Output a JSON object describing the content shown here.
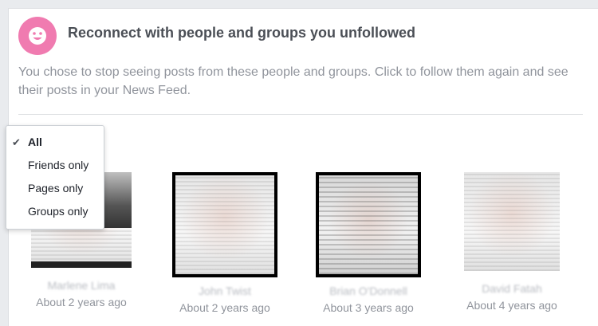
{
  "header": {
    "icon": "smiley-icon",
    "icon_color": "#f07bb0",
    "title": "Reconnect with people and groups you unfollowed",
    "description": "You chose to stop seeing posts from these people and groups. Click to follow them again and see their posts in your News Feed."
  },
  "filter_menu": {
    "selected": "All",
    "items": [
      {
        "label": "All",
        "checked": true,
        "check_icon": "checkmark-icon"
      },
      {
        "label": "Friends only",
        "checked": false
      },
      {
        "label": "Pages only",
        "checked": false
      },
      {
        "label": "Groups only",
        "checked": false
      }
    ]
  },
  "profiles": [
    {
      "name": "Marlene Lima",
      "time": "About 2 years ago"
    },
    {
      "name": "John Twist",
      "time": "About 2 years ago"
    },
    {
      "name": "Brian O'Donnell",
      "time": "About 3 years ago"
    },
    {
      "name": "David Fatah",
      "time": "About 4 years ago"
    }
  ]
}
